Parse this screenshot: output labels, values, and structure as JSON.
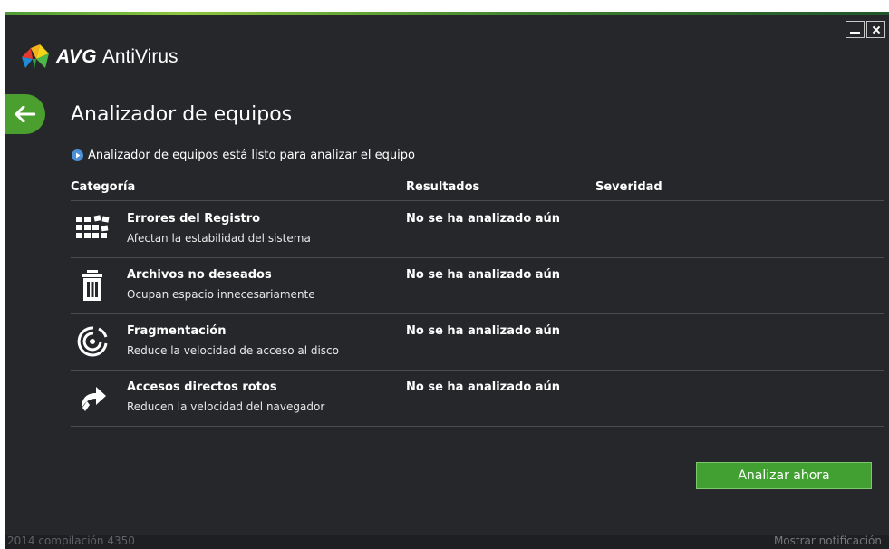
{
  "app": {
    "brand": "AVG",
    "product": "AntiVirus"
  },
  "colors": {
    "accent_green": "#42a033",
    "background": "#25272a",
    "status_blue": "#4b8fd6"
  },
  "page": {
    "title": "Analizador de equipos",
    "status": "Analizador de equipos está listo para analizar el equipo"
  },
  "table": {
    "headers": {
      "category": "Categoría",
      "results": "Resultados",
      "severity": "Severidad"
    },
    "rows": [
      {
        "icon": "registry-grid-icon",
        "title": "Errores del Registro",
        "description": "Afectan la estabilidad del sistema",
        "result": "No se ha analizado aún"
      },
      {
        "icon": "trash-can-icon",
        "title": "Archivos no deseados",
        "description": "Ocupan espacio innecesariamente",
        "result": "No se ha analizado aún"
      },
      {
        "icon": "disk-fragmentation-icon",
        "title": "Fragmentación",
        "description": "Reduce la velocidad de acceso al disco",
        "result": "No se ha analizado aún"
      },
      {
        "icon": "broken-shortcut-arrow-icon",
        "title": "Accesos directos rotos",
        "description": "Reducen la velocidad del navegador",
        "result": "No se ha analizado aún"
      }
    ]
  },
  "actions": {
    "scan_now": "Analizar ahora"
  },
  "footer": {
    "version": "2014  compilación 4350",
    "notification_link": "Mostrar notificación"
  }
}
